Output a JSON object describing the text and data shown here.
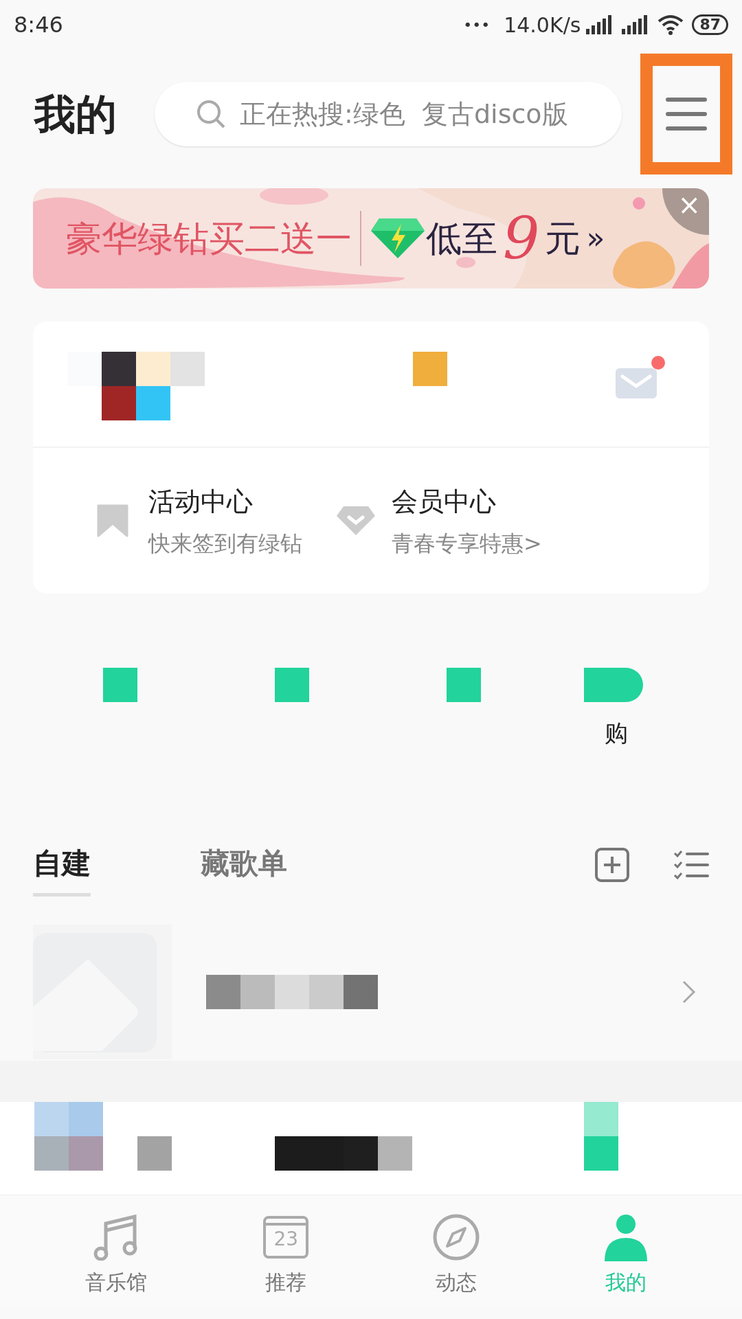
{
  "status_bar": {
    "time": "8:46",
    "dots": "•••",
    "speed": "14.0K/s",
    "battery": "87"
  },
  "header": {
    "title": "我的",
    "search": {
      "placeholder": "正在热搜:绿色  复古disco版"
    }
  },
  "banner": {
    "headline": "豪华绿钻买二送一",
    "price_prefix": "低至",
    "price": "9",
    "price_unit": "元",
    "arrow": "»",
    "close": "×"
  },
  "profile_card": {
    "mail_unread": true,
    "links": [
      {
        "kind": "bookmark",
        "title": "活动中心",
        "subtitle": "快来签到有绿钻"
      },
      {
        "kind": "diamond",
        "title": "会员中心",
        "subtitle": "青春专享特惠>"
      }
    ]
  },
  "shortcut_caption": "购",
  "playlist_tabs": [
    {
      "label": "自建",
      "selected": true
    },
    {
      "label": "藏歌单",
      "selected": false
    }
  ],
  "bottom_nav": [
    {
      "kind": "music",
      "label": "音乐馆",
      "selected": false
    },
    {
      "kind": "calendar",
      "label": "推荐",
      "selected": false,
      "day": "23"
    },
    {
      "kind": "compass",
      "label": "动态",
      "selected": false
    },
    {
      "kind": "person",
      "label": "我的",
      "selected": true
    }
  ]
}
